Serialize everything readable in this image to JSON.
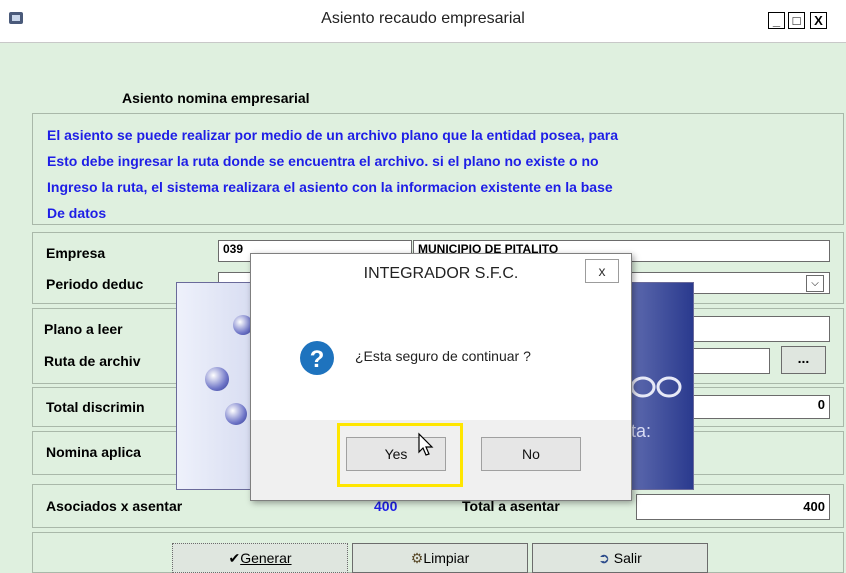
{
  "window": {
    "title": "Asiento recaudo empresarial",
    "minimize": "_",
    "maximize": "□",
    "close": "X"
  },
  "heading": "Asiento nomina empresarial",
  "info_lines": [
    "El asiento se puede realizar por medio de un archivo plano que la entidad posea, para",
    "Esto debe ingresar la ruta donde se encuentra el archivo. si el plano no existe o no",
    "Ingreso la ruta, el sistema realizara el asiento con la informacion existente en la base",
    "De datos"
  ],
  "form": {
    "empresa_label": "Empresa",
    "empresa_code": "039",
    "empresa_name": "MUNICIPIO DE PITALITO",
    "periodo_label": "Periodo deduc",
    "plano_label": "Plano a leer",
    "ruta_label": "Ruta de archiv",
    "browse_label": "...",
    "total_discrim_label": "Total discrimin",
    "total_discrim_value": "0",
    "nomina_label": "Nomina aplica",
    "asociados_label": "Asociados x asentar",
    "asociados_value": "400",
    "total_asentar_label": "Total a asentar",
    "total_asentar_value": "400"
  },
  "buttons": {
    "generar": "Generar",
    "limpiar": "Limpiar",
    "salir": "Salir"
  },
  "dialog": {
    "title": "INTEGRADOR S.F.C.",
    "close": "x",
    "message": "¿Esta seguro de continuar ?",
    "yes": "Yes",
    "no": "No"
  },
  "splash_partial_text": "ta:",
  "colors": {
    "background": "#dff0df",
    "info_text": "#1e1ee6",
    "highlight": "#ffe600",
    "question_icon": "#1e73be"
  }
}
